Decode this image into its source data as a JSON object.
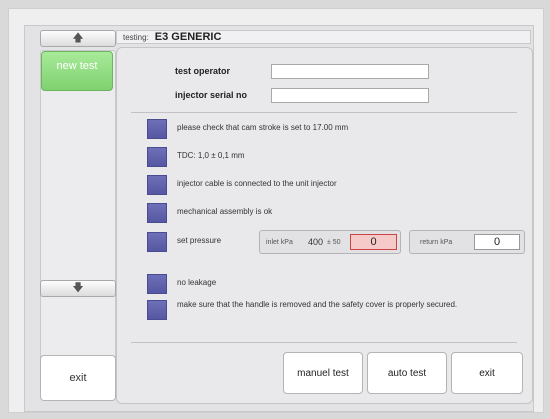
{
  "sidebar": {
    "new_test": "new test",
    "exit": "exit"
  },
  "header": {
    "prefix": "testing:",
    "title": "E3 GENERIC"
  },
  "form": {
    "operator_label": "test operator",
    "operator_value": "",
    "serial_label": "injector serial no",
    "serial_value": ""
  },
  "checklist": [
    {
      "text": "please check that cam stroke is set to 17.00 mm"
    },
    {
      "text": "TDC: 1,0 ± 0,1 mm"
    },
    {
      "text": "injector cable is connected to the unit injector"
    },
    {
      "text": "mechanical assembly is ok"
    },
    {
      "text": "set pressure"
    },
    {
      "text": "no leakage"
    },
    {
      "text": "make sure that the handle is removed and the safety cover is properly secured."
    }
  ],
  "pressure": {
    "inlet_label": "inlet kPa",
    "inlet_target": "400",
    "inlet_tolerance": "± 50",
    "inlet_value": "0",
    "return_label": "return kPa",
    "return_value": "0"
  },
  "buttons": {
    "manual_test": "manuel test",
    "auto_test": "auto test",
    "exit": "exit"
  },
  "colors": {
    "accent_green": "#8bdc7b",
    "check_square": "#5f61ad",
    "alert_red": "#f7caca"
  }
}
